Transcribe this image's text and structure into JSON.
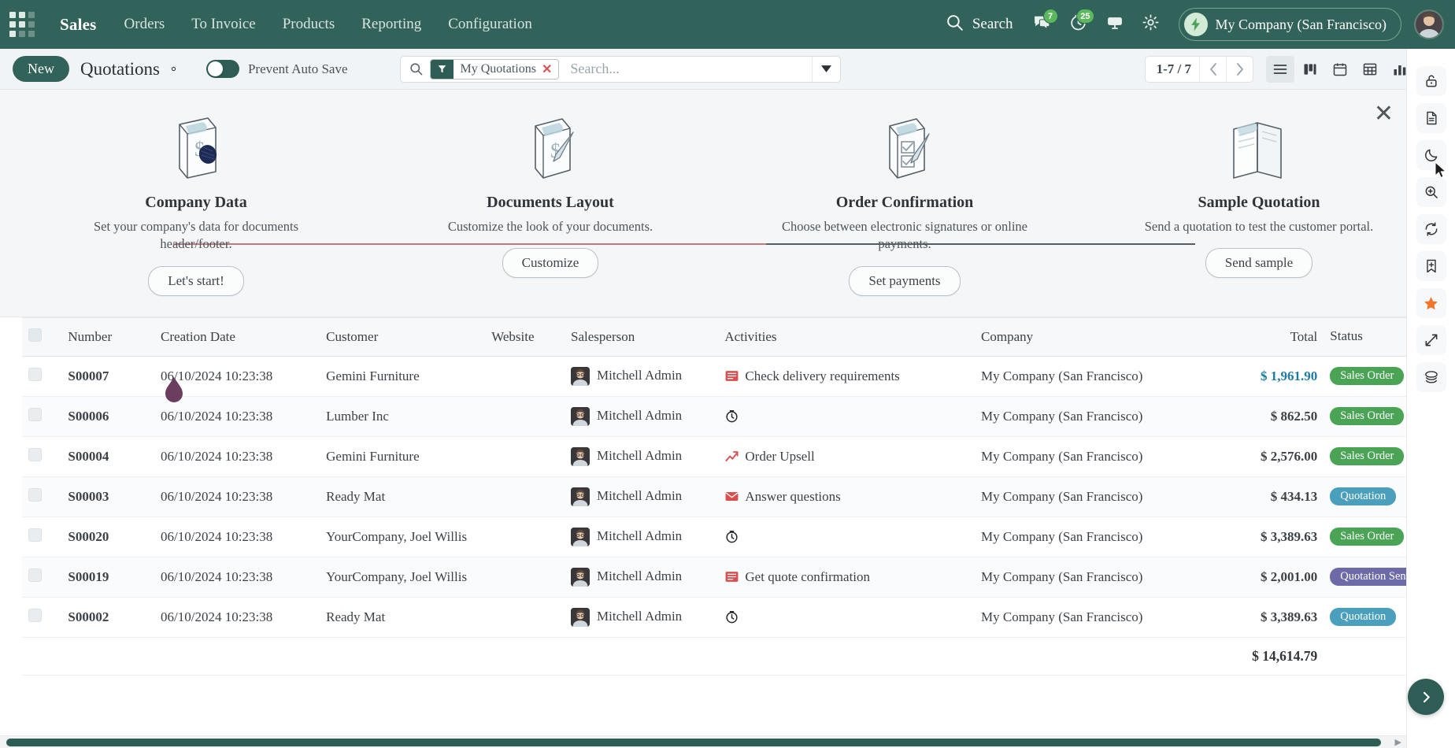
{
  "navbar": {
    "apps_icon": "apps-grid-icon",
    "brand": "Sales",
    "menus": [
      "Orders",
      "To Invoice",
      "Products",
      "Reporting",
      "Configuration"
    ],
    "search_label": "Search",
    "messages_badge": "7",
    "activities_badge": "25",
    "company_name": "My Company (San Francisco)"
  },
  "control_panel": {
    "new_label": "New",
    "title": "Quotations",
    "toggle_label": "Prevent Auto Save",
    "toggle_state": "off",
    "facet_label": "My Quotations",
    "search_placeholder": "Search...",
    "search_value": "",
    "pager": "1-7 / 7",
    "views": [
      "list-view",
      "kanban-view",
      "calendar-view",
      "pivot-view",
      "graph-view",
      "activity-view"
    ],
    "active_view": "list-view"
  },
  "onboarding": {
    "close_label": "✕",
    "steps": [
      {
        "title": "Company Data",
        "desc": "Set your company's data for documents header/footer.",
        "button": "Let's start!",
        "icon": "document-dollar-icon"
      },
      {
        "title": "Documents Layout",
        "desc": "Customize the look of your documents.",
        "button": "Customize",
        "icon": "document-pen-icon"
      },
      {
        "title": "Order Confirmation",
        "desc": "Choose between electronic signatures or online payments.",
        "button": "Set payments",
        "icon": "checklist-pen-icon"
      },
      {
        "title": "Sample Quotation",
        "desc": "Send a quotation to test the customer portal.",
        "button": "Send sample",
        "icon": "open-book-icon"
      }
    ]
  },
  "table": {
    "columns": [
      "Number",
      "Creation Date",
      "Customer",
      "Website",
      "Salesperson",
      "Activities",
      "Company",
      "Total",
      "Status"
    ],
    "rows": [
      {
        "number": "S00007",
        "date": "06/10/2024 10:23:38",
        "customer": "Gemini Furniture",
        "website": "",
        "salesperson": "Mitchell Admin",
        "activity": "Check delivery requirements",
        "activity_icon": "list-red-icon",
        "company": "My Company (San Francisco)",
        "total": "$ 1,961.90",
        "total_link": true,
        "status": "Sales Order",
        "status_type": "so"
      },
      {
        "number": "S00006",
        "date": "06/10/2024 10:23:38",
        "customer": "Lumber Inc",
        "website": "",
        "salesperson": "Mitchell Admin",
        "activity": "",
        "activity_icon": "clock-icon",
        "company": "My Company (San Francisco)",
        "total": "$ 862.50",
        "total_link": false,
        "status": "Sales Order",
        "status_type": "so"
      },
      {
        "number": "S00004",
        "date": "06/10/2024 10:23:38",
        "customer": "Gemini Furniture",
        "website": "",
        "salesperson": "Mitchell Admin",
        "activity": "Order Upsell",
        "activity_icon": "chart-up-red-icon",
        "company": "My Company (San Francisco)",
        "total": "$ 2,576.00",
        "total_link": false,
        "status": "Sales Order",
        "status_type": "so"
      },
      {
        "number": "S00003",
        "date": "06/10/2024 10:23:38",
        "customer": "Ready Mat",
        "website": "",
        "salesperson": "Mitchell Admin",
        "activity": "Answer questions",
        "activity_icon": "envelope-red-icon",
        "company": "My Company (San Francisco)",
        "total": "$ 434.13",
        "total_link": false,
        "status": "Quotation",
        "status_type": "q"
      },
      {
        "number": "S00020",
        "date": "06/10/2024 10:23:38",
        "customer": "YourCompany, Joel Willis",
        "website": "",
        "salesperson": "Mitchell Admin",
        "activity": "",
        "activity_icon": "clock-icon",
        "company": "My Company (San Francisco)",
        "total": "$ 3,389.63",
        "total_link": false,
        "status": "Sales Order",
        "status_type": "so"
      },
      {
        "number": "S00019",
        "date": "06/10/2024 10:23:38",
        "customer": "YourCompany, Joel Willis",
        "website": "",
        "salesperson": "Mitchell Admin",
        "activity": "Get quote confirmation",
        "activity_icon": "list-red-icon",
        "company": "My Company (San Francisco)",
        "total": "$ 2,001.00",
        "total_link": false,
        "status": "Quotation Sent",
        "status_type": "qs"
      },
      {
        "number": "S00002",
        "date": "06/10/2024 10:23:38",
        "customer": "Ready Mat",
        "website": "",
        "salesperson": "Mitchell Admin",
        "activity": "",
        "activity_icon": "clock-icon",
        "company": "My Company (San Francisco)",
        "total": "$ 3,389.63",
        "total_link": false,
        "status": "Quotation",
        "status_type": "q"
      }
    ],
    "sum_total": "$ 14,614.79"
  },
  "rail": {
    "items": [
      "unlock-icon",
      "document-icon",
      "moon-icon",
      "zoom-in-icon",
      "refresh-icon",
      "bookmark-plus-icon",
      "star-icon",
      "expand-icon",
      "layers-icon"
    ],
    "fab": "chevron-right-icon"
  },
  "colors": {
    "brand_green": "#31635a",
    "badge_sales_order": "#4ba356",
    "badge_quotation": "#4a9fbd",
    "badge_quotation_sent": "#6d6aa8",
    "star_orange": "#f0762a",
    "link_blue": "#1d7ca3"
  }
}
